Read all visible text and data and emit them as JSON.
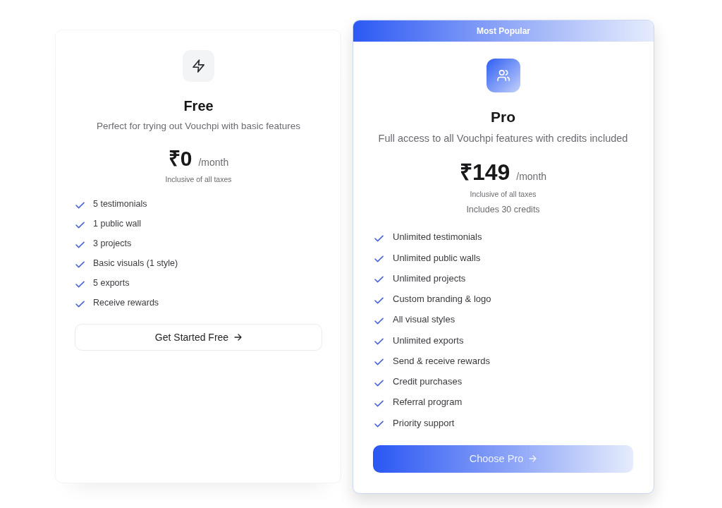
{
  "plans": [
    {
      "kind": "standard",
      "name": "Free",
      "description": "Perfect for trying out Vouchpi with basic features",
      "price": "₹0",
      "period": "/month",
      "tax_note": "Inclusive of all taxes",
      "features": [
        "5 testimonials",
        "1 public wall",
        "3 projects",
        "Basic visuals (1 style)",
        "5 exports",
        "Receive rewards"
      ],
      "button": "Get Started Free"
    },
    {
      "kind": "featured",
      "badge": "Most Popular",
      "name": "Pro",
      "description": "Full access to all Vouchpi features with credits included",
      "price": "₹149",
      "period": "/month",
      "tax_note": "Inclusive of all taxes",
      "credits_note": "Includes 30 credits",
      "features": [
        "Unlimited testimonials",
        "Unlimited public walls",
        "Unlimited projects",
        "Custom branding & logo",
        "All visual styles",
        "Unlimited exports",
        "Send & receive rewards",
        "Credit purchases",
        "Referral program",
        "Priority support"
      ],
      "button": "Choose Pro"
    }
  ]
}
